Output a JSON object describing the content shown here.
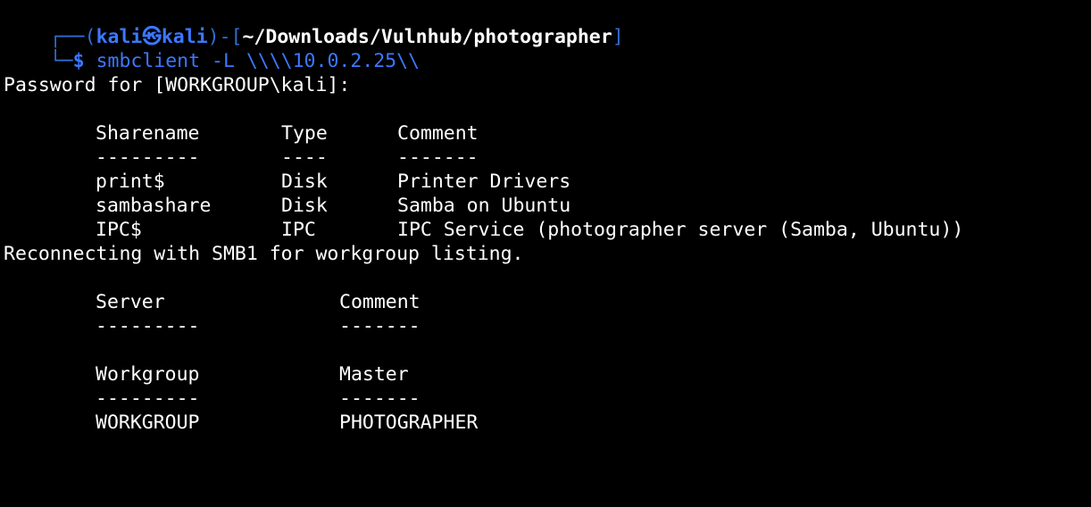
{
  "prompt": {
    "box_top": "┌──(",
    "user": "kali",
    "at_icon": "㉿",
    "host": "kali",
    "box_mid": ")-[",
    "path": "~/Downloads/Vulnhub/photographer",
    "box_end": "]",
    "box_bottom": "└─",
    "dollar": "$ ",
    "command": "smbclient",
    "args": " -L \\\\\\\\10.0.2.25\\\\"
  },
  "password_prompt": "Password for [WORKGROUP\\kali]:",
  "shares": {
    "headers": [
      "Sharename",
      "Type",
      "Comment"
    ],
    "dashes": [
      "---------",
      "----",
      "-------"
    ],
    "rows": [
      [
        "print$",
        "Disk",
        "Printer Drivers"
      ],
      [
        "sambashare",
        "Disk",
        "Samba on Ubuntu"
      ],
      [
        "IPC$",
        "IPC",
        "IPC Service (photographer server (Samba, Ubuntu))"
      ]
    ]
  },
  "reconnect_message": "Reconnecting with SMB1 for workgroup listing.",
  "servers": {
    "headers": [
      "Server",
      "Comment"
    ],
    "dashes": [
      "---------",
      "-------"
    ]
  },
  "workgroups": {
    "headers": [
      "Workgroup",
      "Master"
    ],
    "dashes": [
      "---------",
      "-------"
    ],
    "rows": [
      [
        "WORKGROUP",
        "PHOTOGRAPHER"
      ]
    ]
  }
}
